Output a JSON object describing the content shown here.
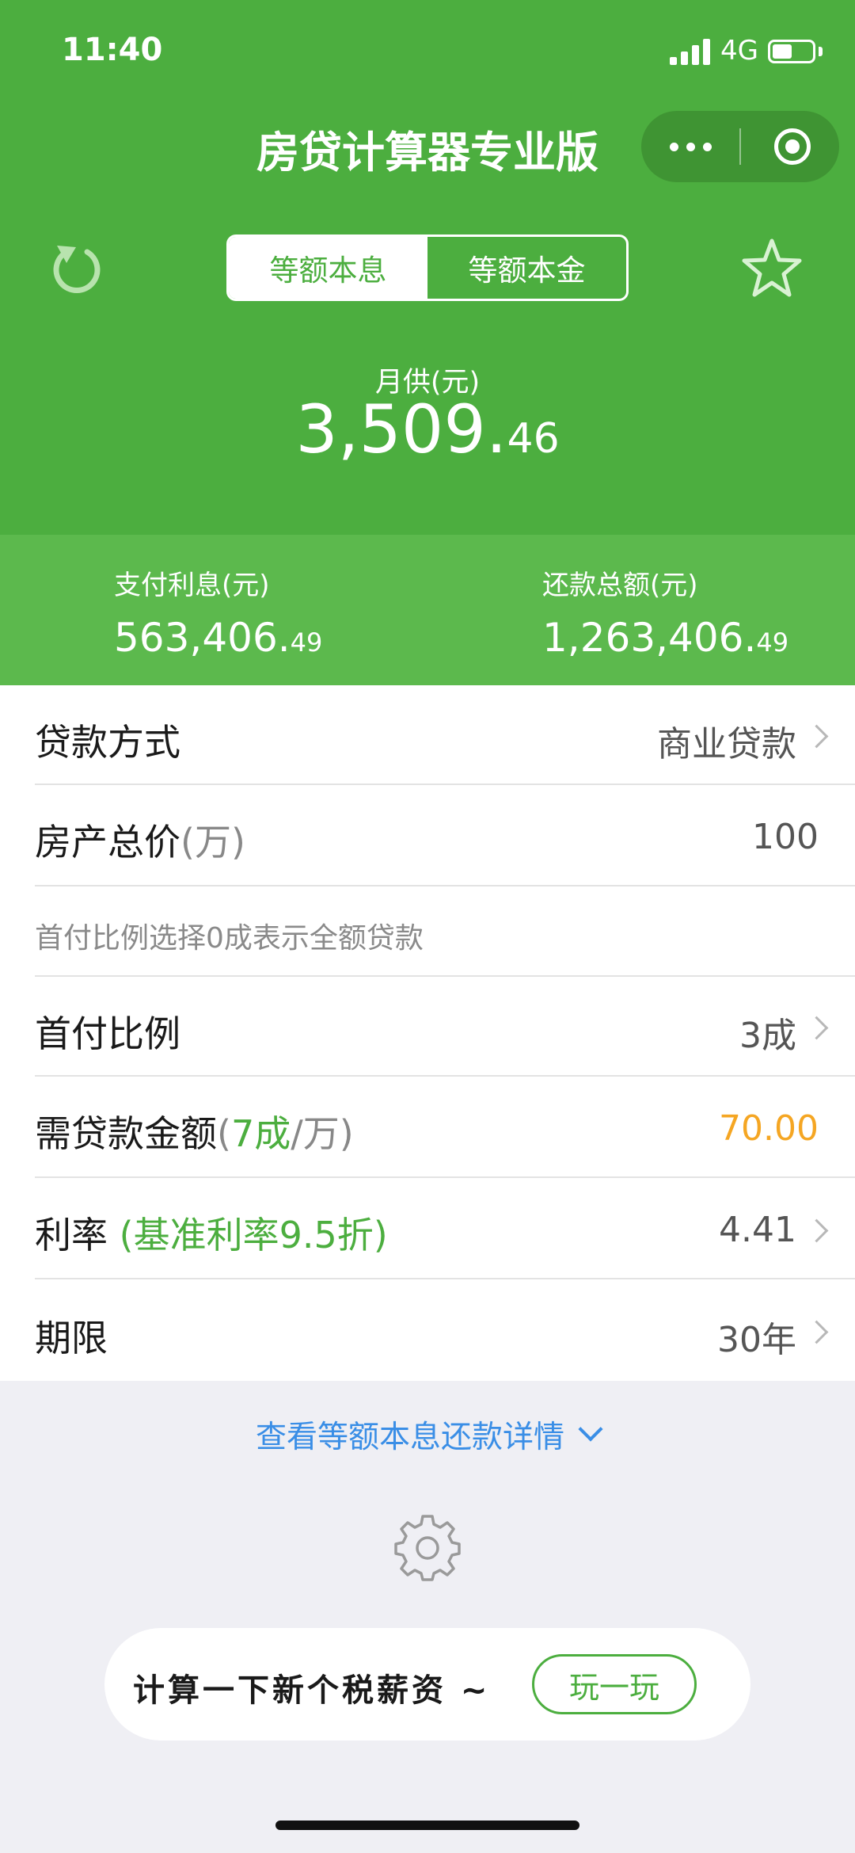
{
  "status_bar": {
    "time": "11:40",
    "network": "4G"
  },
  "app": {
    "title": "房贷计算器专业版"
  },
  "tabs": [
    {
      "label": "等额本息",
      "active": true
    },
    {
      "label": "等额本金",
      "active": false
    }
  ],
  "monthly": {
    "label": "月供(元)",
    "integer": "3,509.",
    "decimal": "46"
  },
  "summary": {
    "interest": {
      "label": "支付利息(元)",
      "integer": "563,406.",
      "decimal": "49"
    },
    "total": {
      "label": "还款总额(元)",
      "integer": "1,263,406.",
      "decimal": "49"
    }
  },
  "form": {
    "loan_type": {
      "label": "贷款方式",
      "value": "商业贷款"
    },
    "total_price": {
      "label": "房产总价",
      "unit": "(万)",
      "value": "100"
    },
    "hint": "首付比例选择0成表示全额贷款",
    "down_payment": {
      "label": "首付比例",
      "value": "3成"
    },
    "loan_amount": {
      "label": "需贷款金额",
      "paren_open": "(",
      "ratio": "7成",
      "unit": "/万)",
      "value": "70.00"
    },
    "rate": {
      "label": "利率 ",
      "note": "(基准利率9.5折)",
      "value": "4.41"
    },
    "term": {
      "label": "期限",
      "value": "30年"
    }
  },
  "detail_link": "查看等额本息还款详情",
  "promo": {
    "text": "计算一下新个税薪资 ~",
    "button": "玩一玩"
  },
  "icons": [
    "refresh-icon",
    "star-icon",
    "more-icon",
    "close-mini-program-icon",
    "chevron-right-icon",
    "chevron-down-icon",
    "settings-icon"
  ],
  "colors": {
    "primary": "#4cae3f",
    "summary_bg": "#5cb94d",
    "accent_orange": "#f5a623",
    "link_blue": "#3a8ee6",
    "background": "#efeff4"
  }
}
